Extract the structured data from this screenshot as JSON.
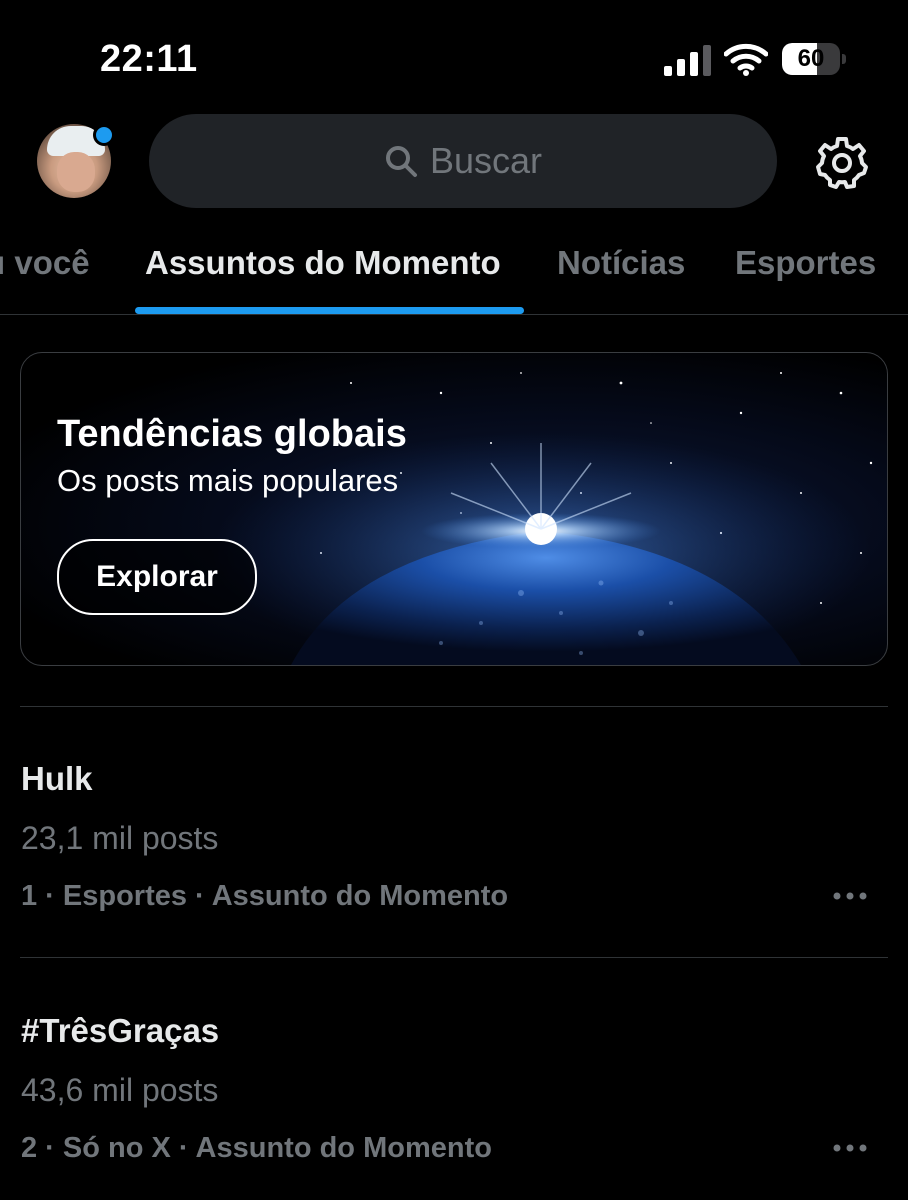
{
  "status_bar": {
    "time": "22:11",
    "battery_level": "60",
    "battery_fraction": 0.6
  },
  "header": {
    "search_placeholder": "Buscar",
    "accent_color": "#1d9bf0"
  },
  "tabs": [
    {
      "label": "Para você",
      "visible_label": "ı você",
      "active": false
    },
    {
      "label": "Assuntos do Momento",
      "active": true
    },
    {
      "label": "Notícias",
      "active": false
    },
    {
      "label": "Esportes",
      "active": false
    }
  ],
  "banner": {
    "title": "Tendências globais",
    "subtitle": "Os posts mais populares",
    "button_label": "Explorar"
  },
  "trends": [
    {
      "name": "Hulk",
      "posts": "23,1 mil posts",
      "meta": "1 · Esportes · Assunto do Momento"
    },
    {
      "name": "#TrêsGraças",
      "posts": "43,6 mil posts",
      "meta": "2 · Só no X · Assunto do Momento"
    }
  ],
  "icons": {
    "search": "search-icon",
    "settings": "gear-icon",
    "more": "more-icon",
    "signal": "signal-icon",
    "wifi": "wifi-icon"
  }
}
